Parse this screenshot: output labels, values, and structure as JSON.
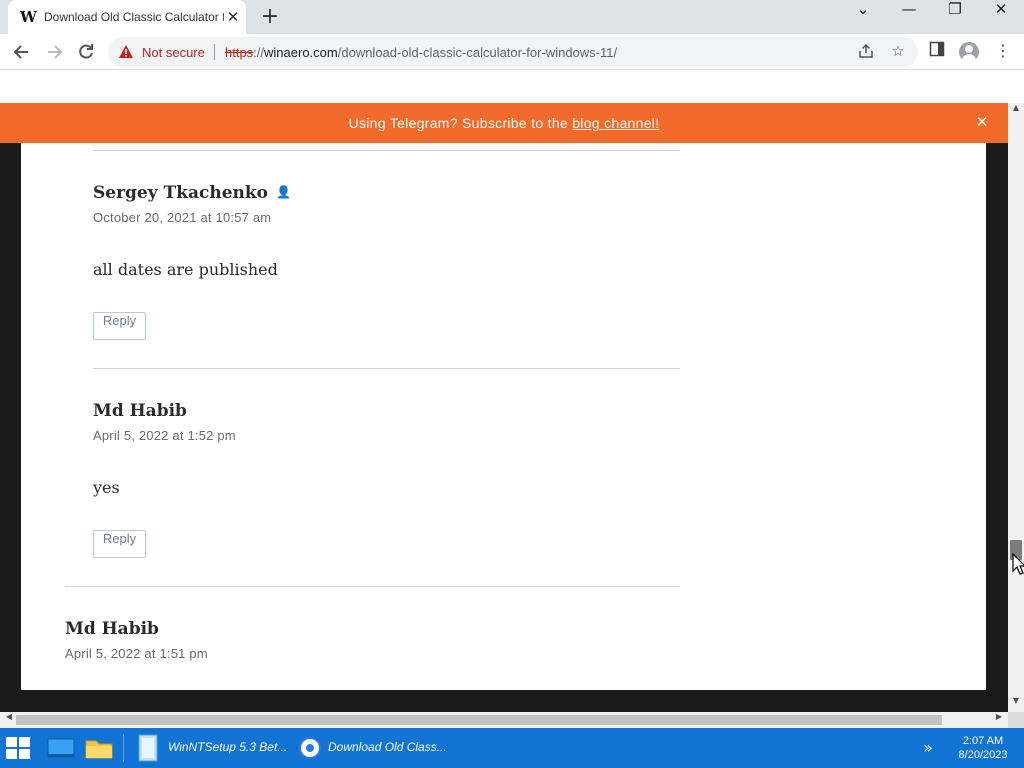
{
  "browser": {
    "tab_title": "Download Old Classic Calculator f",
    "favicon_letter": "W",
    "new_tab": "+",
    "close_tab": "✕"
  },
  "window": {
    "caret": "⌄",
    "minimize": "—",
    "restore": "❐",
    "close": "✕"
  },
  "toolbar": {
    "not_secure": "Not secure",
    "url_scheme": "https",
    "url_sep": "://",
    "url_host": "winaero.com",
    "url_path": "/download-old-classic-calculator-for-windows-11/"
  },
  "banner": {
    "text": "Using Telegram? Subscribe to the ",
    "link": "blog channel!",
    "close": "✕",
    "color": "#f26b2a"
  },
  "comments": [
    {
      "author": "Sergey Tkachenko",
      "is_admin": true,
      "date": "October 20, 2021 at 10:57 am",
      "text": "all dates are published",
      "reply_label": "Reply"
    },
    {
      "author": "Md Habib",
      "date": "April 5, 2022 at 1:52 pm",
      "text": "yes",
      "reply_label": "Reply"
    },
    {
      "author": "Md Habib",
      "date": "April 5, 2022 at 1:51 pm"
    }
  ],
  "taskbar": {
    "items": [
      {
        "label": "WinNTSetup 5.3 Bet..."
      },
      {
        "label": "Download Old Class..."
      }
    ],
    "time": "2:07 AM",
    "date": "8/20/2023",
    "accent": "#1173d4"
  }
}
